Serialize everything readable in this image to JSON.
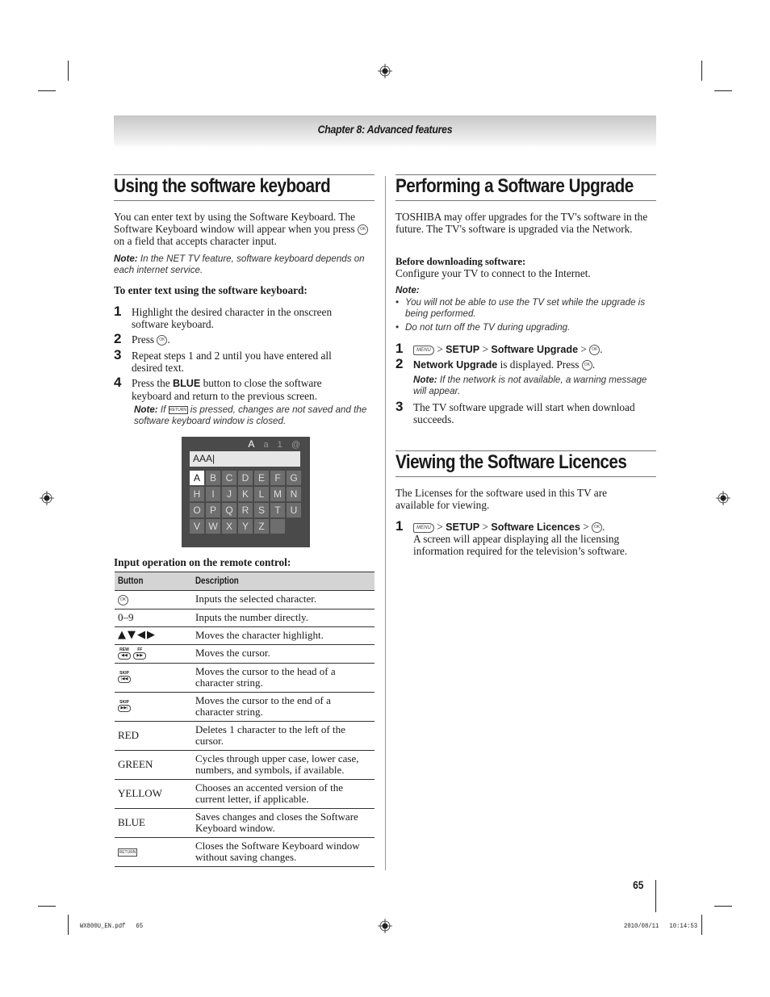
{
  "header": {
    "chapter": "Chapter 8: Advanced features"
  },
  "left": {
    "title": "Using the software keyboard",
    "intro_before": "You can enter text by using the Software Keyboard. The Software Keyboard window will appear when you press",
    "intro_after": "on a field that accepts character input.",
    "note_label": "Note:",
    "note_text": "In the NET TV feature, software keyboard depends on each internet service.",
    "procedure_heading": "To enter text using the software keyboard:",
    "steps": [
      {
        "num": "1",
        "text": "Highlight the desired character in the onscreen software keyboard."
      },
      {
        "num": "2",
        "text_before": "Press",
        "text_after": "."
      },
      {
        "num": "3",
        "text": "Repeat steps 1 and 2 until you have entered all desired text."
      },
      {
        "num": "4",
        "text_before": "Press the",
        "bold": "BLUE",
        "text_after": "button to close the software keyboard and return to the previous screen."
      }
    ],
    "step4_note_label": "Note:",
    "step4_note_before": "If",
    "step4_note_after": "is pressed, changes are not saved and the software keyboard window is closed.",
    "keyboard": {
      "modes": [
        "A",
        "a",
        "1",
        "@"
      ],
      "active_mode": "A",
      "input_value": "AAA|",
      "keys": [
        "A",
        "B",
        "C",
        "D",
        "E",
        "F",
        "G",
        "H",
        "I",
        "J",
        "K",
        "L",
        "M",
        "N",
        "O",
        "P",
        "Q",
        "R",
        "S",
        "T",
        "U",
        "V",
        "W",
        "X",
        "Y",
        "Z",
        ""
      ],
      "selected_key": "A"
    },
    "table": {
      "caption": "Input operation on the remote control:",
      "headers": [
        "Button",
        "Description"
      ],
      "rows": [
        {
          "button": "ok-icon",
          "description": "Inputs the selected character."
        },
        {
          "button": "0–9",
          "description": "Inputs the number directly."
        },
        {
          "button": "▲▼◀▶",
          "description": "Moves the character highlight."
        },
        {
          "button": "rew-ff-icons",
          "description": "Moves the cursor."
        },
        {
          "button": "skip-back-icon",
          "description": "Moves the cursor to the head of a character string."
        },
        {
          "button": "skip-forward-icon",
          "description": "Moves the cursor to the end of a character string."
        },
        {
          "button": "RED",
          "description": "Deletes 1 character to the left of the cursor."
        },
        {
          "button": "GREEN",
          "description": "Cycles through upper case, lower case, numbers, and symbols, if available."
        },
        {
          "button": "YELLOW",
          "description": "Chooses an accented version of the current letter, if applicable."
        },
        {
          "button": "BLUE",
          "description": "Saves changes and closes the Software Keyboard window."
        },
        {
          "button": "return-icon",
          "description": "Closes the Software Keyboard window without saving changes."
        }
      ]
    }
  },
  "right": {
    "upgrade": {
      "title": "Performing a Software Upgrade",
      "intro": "TOSHIBA may offer upgrades for the TV's software in the future. The TV's software is upgraded via the Network.",
      "before_heading": "Before downloading software:",
      "before_text": "Configure your TV to connect to the Internet.",
      "note_label": "Note:",
      "note_bullets": [
        "You will not be able to use the TV set while the upgrade is being performed.",
        "Do not turn off the TV during upgrading."
      ],
      "steps": [
        {
          "num": "1",
          "sep": ">",
          "path1": "SETUP",
          "path2": "Software Upgrade"
        },
        {
          "num": "2",
          "bold": "Network Upgrade",
          "text": "is displayed. Press"
        },
        {
          "num": "3",
          "text": "The TV software upgrade will start when download succeeds."
        }
      ],
      "step2_note_label": "Note:",
      "step2_note_text": "If the network is not available, a warning message will appear."
    },
    "licences": {
      "title": "Viewing the Software Licences",
      "intro": "The Licenses for the software used in this TV are available for viewing.",
      "step_num": "1",
      "path1": "SETUP",
      "path2": "Software Licences",
      "step_text": "A screen will appear displaying all the licensing information required for the television’s software."
    }
  },
  "icons": {
    "ok": "OK",
    "menu": "MENU",
    "return": "RETURN",
    "rew": "REW",
    "ff": "FF",
    "skip": "SKIP"
  },
  "footer": {
    "page_number": "65",
    "slug_left": "WX800U_EN.pdf   65",
    "slug_right": "2010/08/11   10:14:53"
  }
}
